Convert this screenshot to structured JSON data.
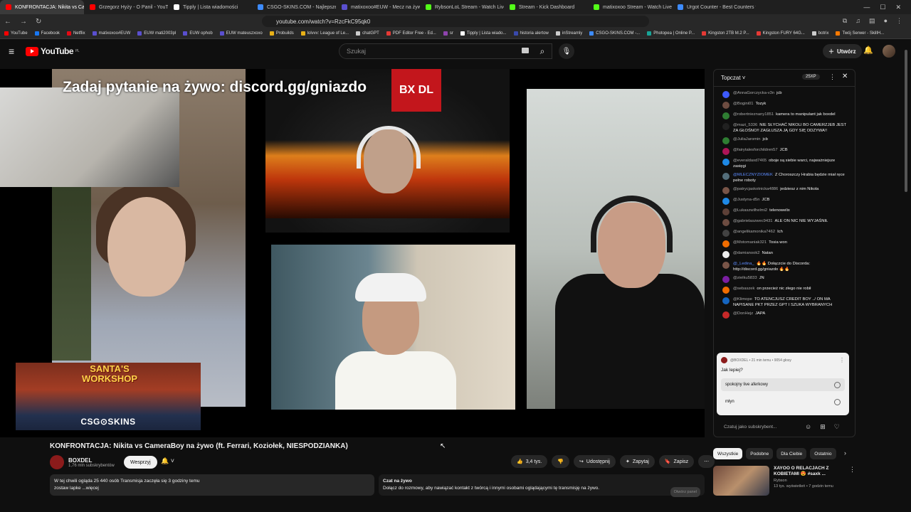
{
  "browser": {
    "tabs": [
      {
        "label": "KONFRONTACJA: Nikita vs Ca",
        "color": "#ff0000",
        "active": true
      },
      {
        "label": "Grzegorz Hyży - O Panil - YouTube",
        "color": "#ff0000"
      },
      {
        "label": "Tipply | Lista wiadomości",
        "color": "#ffffff"
      },
      {
        "label": "CSGO-SKINS.COM - Najlepsze Skrzy",
        "color": "#3d8bfd"
      },
      {
        "label": "matixoxoo#EUW - Mecz na żywo - L",
        "color": "#5a4fcf"
      },
      {
        "label": "RybsonLoL Stream - Watch Live on K",
        "color": "#53fc18"
      },
      {
        "label": "Stream - Kick Dashboard",
        "color": "#53fc18"
      },
      {
        "label": "matixoxoo Stream - Watch Live on K",
        "color": "#53fc18"
      },
      {
        "label": "Urgot Counter - Best Counters from",
        "color": "#3d8bfd"
      }
    ],
    "url": "youtube.com/watch?v=RzcFkC95qk0",
    "bookmarks": [
      {
        "label": "YouTube",
        "color": "#ff0000"
      },
      {
        "label": "Facebook",
        "color": "#1877f2"
      },
      {
        "label": "Netflix",
        "color": "#e50914"
      },
      {
        "label": "matixoxoo#EUW",
        "color": "#5a4fcf"
      },
      {
        "label": "EUW mati2003pl",
        "color": "#5a4fcf"
      },
      {
        "label": "EUW ophob",
        "color": "#5a4fcf"
      },
      {
        "label": "EUW mateuszxoxo",
        "color": "#5a4fcf"
      },
      {
        "label": "Probuilds",
        "color": "#e8b017"
      },
      {
        "label": "lolvvv: League of Le...",
        "color": "#e8b017"
      },
      {
        "label": "chatGPT",
        "color": "#cccccc"
      },
      {
        "label": "PDF Editor Free - Ed...",
        "color": "#e53935"
      },
      {
        "label": "sr",
        "color": "#8e44ad"
      },
      {
        "label": "Tipply | Lista wiado...",
        "color": "#ffffff"
      },
      {
        "label": "historia alertow",
        "color": "#3949ab"
      },
      {
        "label": "inStreamly",
        "color": "#cccccc"
      },
      {
        "label": "CSGO-SKINS.COM -...",
        "color": "#3d8bfd"
      },
      {
        "label": "Photopea | Online P...",
        "color": "#18a497"
      },
      {
        "label": "Kingston 2TB M.2 P...",
        "color": "#e53935"
      },
      {
        "label": "Kingston FURY 64G...",
        "color": "#e53935"
      },
      {
        "label": "botrix",
        "color": "#cccccc"
      },
      {
        "label": "Twój Serwer - SkillH...",
        "color": "#ff7a00"
      }
    ]
  },
  "header": {
    "logo_text": "YouTube",
    "logo_region": "PL",
    "search_placeholder": "Szukaj",
    "create_label": "Utwórz"
  },
  "video": {
    "overlay_text": "Zadaj pytanie na żywo: discord.gg/gniazdo",
    "ad_title": "SANTA'S WORKSHOP",
    "ad_brand": "CSG⊙SKINS",
    "stream_logo": "BX DL",
    "title": "KONFRONTACJA: Nikita vs CameraBoy na żywo (ft. Ferrari, Koziołek, NIESPODZIANKA)"
  },
  "channel": {
    "name": "BOXDEL",
    "subscribers": "1,76 mln subskrybentów",
    "support_label": "Wesprzyj"
  },
  "actions": {
    "likes": "3,4 tys.",
    "share": "Udostępnij",
    "ask": "Zapytaj",
    "save": "Zapisz"
  },
  "description": {
    "line1": "W tej chwili ogląda 25 440 osób  Transmisja zaczęła się 3 godziny temu",
    "line2": "zostaw lapke ...więcej"
  },
  "livechat_bar": {
    "title": "Czat na żywo",
    "text": "Dołącz do rozmowy, aby nawiązać kontakt z twórcą i innymi osobami oglądającymi tę transmisję na żywo.",
    "button": "Otwórz panel"
  },
  "chat": {
    "mode": "Topczat",
    "xp": "25XP",
    "messages": [
      {
        "author": "@AnnaGorczycka-v3n",
        "text": "jcb",
        "color": "#3d5afe"
      },
      {
        "author": "@Bogini01",
        "text": "Tozyk",
        "color": "#6d4c41"
      },
      {
        "author": "@robertnieznany1851",
        "text": "kamera to manipulant jak boxdel",
        "color": "#2e7d32"
      },
      {
        "author": "@mazi_5336",
        "text": "NIE SŁYCHAĆ NIKOLI BO CAMERZJEB JEST ZA GŁOŚNO!! ZAGŁUSZA JĄ GDY SIĘ ODZYWA!!",
        "color": "#212121"
      },
      {
        "author": "@JuliaJaromin",
        "text": "jcb",
        "color": "#2e7d32"
      },
      {
        "author": "@fairytalesforchildren57",
        "text": "JCB",
        "color": "#ad1457"
      },
      {
        "author": "@everaldaxd7465",
        "text": "oboje są siebie warci, najważniejsze zasięgi",
        "color": "#1e88e5"
      },
      {
        "author": "@MLECZNYZIOMEK",
        "text": "Z Choroszczy Hrabia będzie miał ręce pełne roboty",
        "color": "#546e7a",
        "blue": true
      },
      {
        "author": "@patrycjaskotnicka4886",
        "text": "jedziesz z nim Nikola",
        "color": "#795548"
      },
      {
        "author": "@Justyna-d5n",
        "text": "JCB",
        "color": "#1e88e5"
      },
      {
        "author": "@Lukaszwilhelmi2",
        "text": "telenowelix",
        "color": "#5d4037"
      },
      {
        "author": "@gabrielaszwec9431",
        "text": "ALE ON NIC NIE WYJAŚNIŁ",
        "color": "#6d4c41"
      },
      {
        "author": "@angelikamonika7462",
        "text": "Ich",
        "color": "#424242"
      },
      {
        "author": "@Motomaniak321",
        "text": "Tosia won",
        "color": "#ef6c00"
      },
      {
        "author": "@damianook2",
        "text": "Natan",
        "color": "#eeeeee"
      },
      {
        "author": "@_Ledina_",
        "text": "🔥🔥 Dołączcie do Discorda: http://discord.gg/gniazdo 🔥🔥",
        "color": "#795548",
        "blue": true
      },
      {
        "author": "@zielku5833",
        "text": "JN",
        "color": "#7b1fa2"
      },
      {
        "author": "@sebaszek",
        "text": "on przecież nic złego nie robił",
        "color": "#ef6c00"
      },
      {
        "author": "@Klimope",
        "text": "TO ATENCJUSZ CREDIT BOY ../ ON MA NAPISANE PKT PRZEZ GPT I SZUKA WYBRANYCH",
        "color": "#1565c0"
      },
      {
        "author": "@DonHejz",
        "text": "JAPA",
        "color": "#c62828"
      }
    ],
    "poll": {
      "meta": "@BOXDEL • 21 min temu • 9054 głosy",
      "question": "Jak lepiej?",
      "options": [
        "spokojny live aferkowy",
        "młyn"
      ]
    },
    "input_placeholder": "Czatuj jako subskrybent..."
  },
  "chips": [
    "Wszystkie",
    "Podobne",
    "Dla Ciebie",
    "Ostatnio"
  ],
  "recommendation": {
    "title": "XAYOO O RELACJACH Z KOBIETAMI 😍 #saxk ...",
    "channel": "Rybson",
    "meta": "13 tys. wyświetleń • 7 godzin temu"
  }
}
